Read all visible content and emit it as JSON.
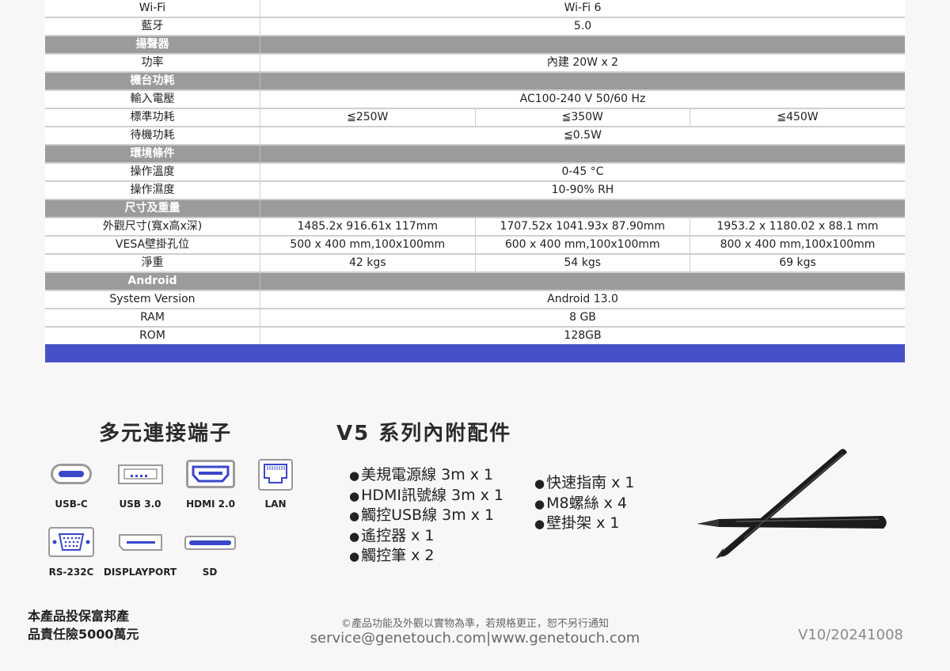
{
  "spec_rows": [
    {
      "type": "row",
      "label": "Wi-Fi",
      "cells": [
        "Wi-Fi 6"
      ]
    },
    {
      "type": "row",
      "label": "藍牙",
      "cells": [
        "5.0"
      ]
    },
    {
      "type": "section",
      "label": "揚聲器"
    },
    {
      "type": "row",
      "label": "功率",
      "cells": [
        "內建 20W x 2"
      ]
    },
    {
      "type": "section",
      "label": "機台功耗"
    },
    {
      "type": "row",
      "label": "輸入電壓",
      "cells": [
        "AC100-240 V  50/60 Hz"
      ]
    },
    {
      "type": "row",
      "label": "標準功耗",
      "cells": [
        "≦250W",
        "≦350W",
        "≦450W"
      ]
    },
    {
      "type": "row",
      "label": "待機功耗",
      "cells": [
        "≦0.5W"
      ]
    },
    {
      "type": "section",
      "label": "環境條件"
    },
    {
      "type": "row",
      "label": "操作溫度",
      "cells": [
        "0-45 °C"
      ]
    },
    {
      "type": "row",
      "label": "操作濕度",
      "cells": [
        "10-90% RH"
      ]
    },
    {
      "type": "section",
      "label": "尺寸及重量"
    },
    {
      "type": "row",
      "label": "外觀尺寸(寬x高x深)",
      "cells": [
        "1485.2x 916.61x 117mm",
        "1707.52x 1041.93x 87.90mm",
        "1953.2 x 1180.02 x 88.1 mm"
      ]
    },
    {
      "type": "row",
      "label": "VESA壁掛孔位",
      "cells": [
        "500 x 400 mm,100x100mm",
        "600 x 400 mm,100x100mm",
        "800 x 400 mm,100x100mm"
      ]
    },
    {
      "type": "row",
      "label": "淨重",
      "cells": [
        "42 kgs",
        "54 kgs",
        "69 kgs"
      ]
    },
    {
      "type": "section",
      "label": "Android"
    },
    {
      "type": "row",
      "label": "System Version",
      "cells": [
        "Android 13.0"
      ]
    },
    {
      "type": "row",
      "label": "RAM",
      "cells": [
        "8 GB"
      ]
    },
    {
      "type": "row",
      "label": "ROM",
      "cells": [
        "128GB"
      ]
    }
  ],
  "ports": {
    "title": "多元連接端子",
    "items": [
      {
        "label": "USB-C",
        "icon": "usb-c-port-icon"
      },
      {
        "label": "USB 3.0",
        "icon": "usb-a-port-icon"
      },
      {
        "label": "HDMI 2.0",
        "icon": "hdmi-port-icon"
      },
      {
        "label": "LAN",
        "icon": "lan-port-icon"
      },
      {
        "label": "RS-232C",
        "icon": "rs232-port-icon"
      },
      {
        "label": "DISPLAYPORT",
        "icon": "displayport-icon"
      },
      {
        "label": "SD",
        "icon": "sd-slot-icon"
      }
    ]
  },
  "accessories": {
    "title": "V5 系列內附配件",
    "col1": [
      "美規電源線 3m x 1",
      "HDMI訊號線 3m x 1",
      "觸控USB線 3m x 1",
      "遙控器 x 1",
      "觸控筆 x 2"
    ],
    "col2": [
      "快速指南 x 1",
      "M8螺絲 x 4",
      "壁掛架 x 1"
    ]
  },
  "footer": {
    "insurance_line1": "本產品投保富邦產",
    "insurance_line2": "品責任險5000萬元",
    "disclaimer": "©產品功能及外觀以實物為準，若規格更正，恕不另行通知",
    "contact": "service@genetouch.com|www.genetouch.com",
    "version": "V10/20241008"
  },
  "colors": {
    "section_bg": "#9b9b9b",
    "accent_bar": "#4651c8",
    "port_blue": "#3a47c8"
  }
}
